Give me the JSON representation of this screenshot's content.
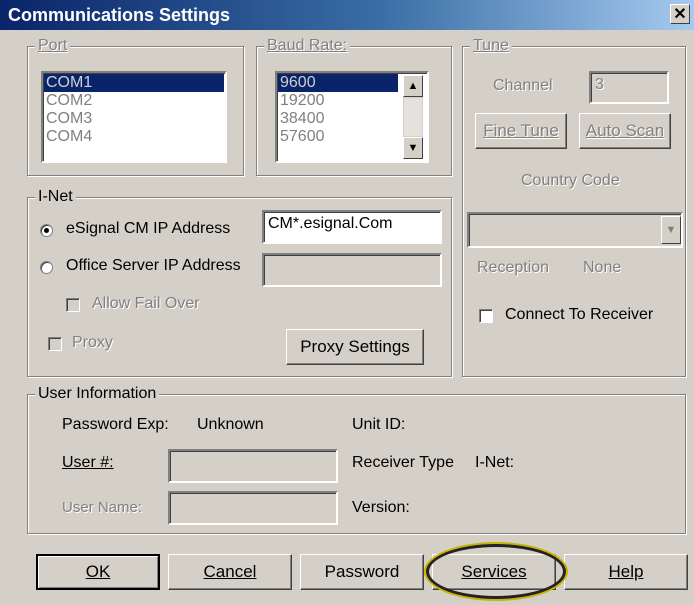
{
  "window": {
    "title": "Communications Settings",
    "close_glyph": "✕"
  },
  "port": {
    "legend": "Port",
    "options": [
      "COM1",
      "COM2",
      "COM3",
      "COM4"
    ],
    "selected": "COM1"
  },
  "baud": {
    "legend": "Baud Rate:",
    "options": [
      "9600",
      "19200",
      "38400",
      "57600"
    ],
    "selected": "9600"
  },
  "tune": {
    "legend": "Tune",
    "channel_label": "Channel",
    "channel_value": "3",
    "fine_tune_label": "Fine Tune",
    "auto_scan_label": "Auto Scan",
    "country_code_label": "Country Code",
    "country_code_value": "",
    "reception_label": "Reception",
    "reception_value": "None",
    "connect_receiver_label": "Connect To Receiver"
  },
  "inet": {
    "legend": "I-Net",
    "esignal_label": "eSignal CM IP Address",
    "esignal_value": "CM*.esignal.Com",
    "office_label": "Office Server IP Address",
    "office_value": "",
    "allow_failover_label": "Allow Fail Over",
    "proxy_label": "Proxy",
    "proxy_settings_label": "Proxy Settings"
  },
  "user_info": {
    "legend": "User Information",
    "password_exp_label": "Password Exp:",
    "password_exp_value": "Unknown",
    "unit_id_label": "Unit ID:",
    "user_num_label": "User #:",
    "receiver_type_label": "Receiver Type",
    "receiver_type_value": "I-Net:",
    "user_name_label": "User Name:",
    "version_label": "Version:"
  },
  "buttons": {
    "ok": "OK",
    "cancel": "Cancel",
    "password": "Password",
    "services": "Services",
    "help": "Help"
  },
  "icons": {
    "scroll_up": "▲",
    "scroll_down": "▼",
    "dropdown": "▼"
  }
}
